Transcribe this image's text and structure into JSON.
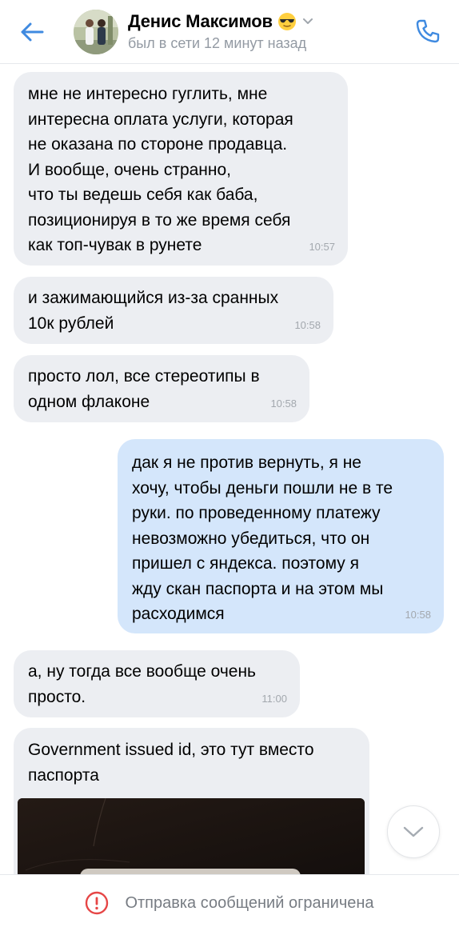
{
  "header": {
    "back_icon": "arrow-left-icon",
    "contact_name": "Денис Максимов",
    "status_emoji": "sunglasses-emoji",
    "status": "был в сети 12 минут назад",
    "call_icon": "phone-icon",
    "accent_color": "#3f8ae0"
  },
  "messages": [
    {
      "direction": "incoming",
      "text": "мне не интересно гуглить, мне\nинтересна оплата услуги, которая\nне оказана по стороне продавца.\nИ вообще, очень странно,\nчто ты ведешь себя как баба,\nпозиционируя в то же время себя\nкак топ-чувак в рунете",
      "time": "10:57"
    },
    {
      "direction": "incoming",
      "text": "и зажимающийся из-за сранных\n10к рублей",
      "time": "10:58"
    },
    {
      "direction": "incoming",
      "text": "просто лол, все стереотипы в\nодном флаконе",
      "time": "10:58"
    },
    {
      "direction": "outgoing",
      "text": "дак я не против вернуть, я не\nхочу, чтобы деньги пошли не в те\nруки. по проведенному платежу\nневозможно убедиться, что он\nпришел с яндекса. поэтому я\nжду скан паспорта и на этом мы\nрасходимся",
      "time": "10:58"
    },
    {
      "direction": "incoming",
      "text": "а, ну тогда все вообще очень\nпросто.",
      "time": "11:00"
    },
    {
      "direction": "incoming",
      "text": "Government issued id, это тут вместо\nпаспорта",
      "attachment": "photo"
    }
  ],
  "scroll_down_icon": "chevron-down-icon",
  "footer": {
    "icon": "warning-circle-icon",
    "text": "Отправка сообщений ограничена",
    "icon_color": "#e64646"
  },
  "colors": {
    "incoming_bubble": "#eceef2",
    "outgoing_bubble": "#d4e6fb",
    "secondary_text": "#939aa3"
  }
}
